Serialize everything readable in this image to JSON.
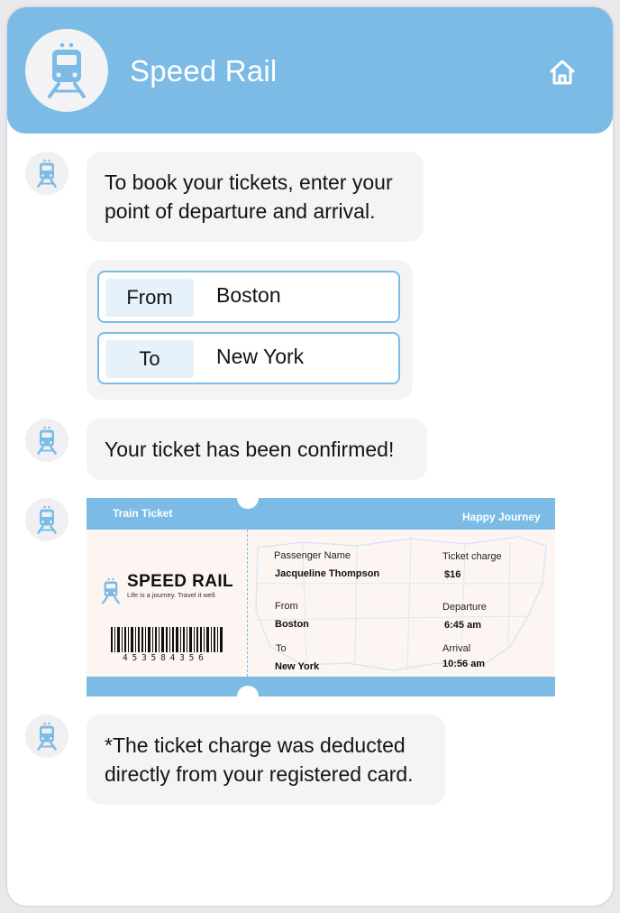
{
  "header": {
    "app_title": "Speed Rail",
    "logo_icon": "train-icon",
    "home_icon": "home-icon",
    "accent_color": "#7bbbe6"
  },
  "messages": [
    {
      "text_lines": [
        "To book your tickets, enter your",
        "point of departure and arrival."
      ]
    },
    {
      "text": "Your ticket has been confirmed!"
    },
    {
      "text_lines": [
        "*The ticket charge was deducted",
        "directly from your registered card."
      ]
    }
  ],
  "route": {
    "from_label": "From",
    "from_value": "Boston",
    "to_label": "To",
    "to_value": "New York"
  },
  "ticket": {
    "header_left": "Train Ticket",
    "header_right": "Happy Journey",
    "brand_name": "SPEED RAIL",
    "brand_tagline": "Life is a journey. Travel it well.",
    "barcode_number": "453584356",
    "passenger_label": "Passenger Name",
    "passenger_value": "Jacqueline Thompson",
    "charge_label": "Ticket charge",
    "charge_value": "$16",
    "from_label": "From",
    "from_value": "Boston",
    "departure_label": "Departure",
    "departure_value": "6:45 am",
    "to_label": "To",
    "to_value": "New York",
    "arrival_label": "Arrival",
    "arrival_value": "10:56 am"
  }
}
